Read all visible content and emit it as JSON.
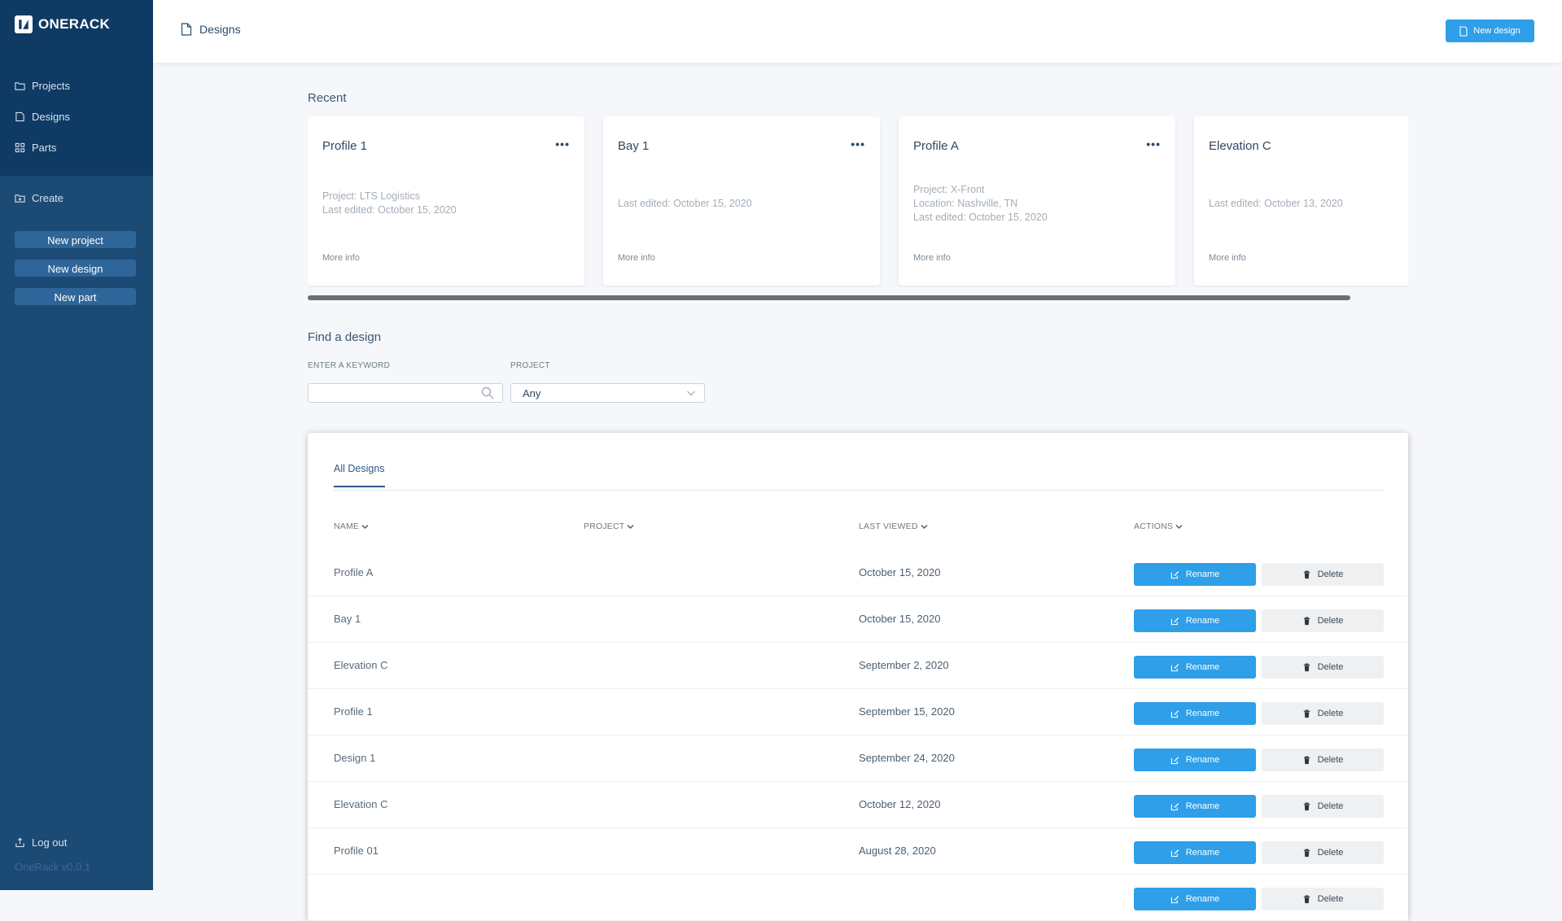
{
  "brand": {
    "name": "ONERACK"
  },
  "sidebar": {
    "nav": [
      {
        "label": "Projects",
        "icon": "folder-icon"
      },
      {
        "label": "Designs",
        "icon": "document-icon"
      },
      {
        "label": "Parts",
        "icon": "parts-icon"
      }
    ],
    "create_label": "Create",
    "create_buttons": [
      "New project",
      "New design",
      "New part"
    ],
    "logout": "Log out",
    "version": "OneRack v0.0.1"
  },
  "topbar": {
    "crumb": "Designs",
    "new_design": "New design"
  },
  "recent": {
    "title": "Recent",
    "cards": [
      {
        "title": "Profile 1",
        "meta": [
          "Project: LTS Logistics",
          "Last edited: October 15, 2020"
        ],
        "more": "More info"
      },
      {
        "title": "Bay 1",
        "meta": [
          "Last edited: October 15, 2020"
        ],
        "more": "More info"
      },
      {
        "title": "Profile A",
        "meta": [
          "Project: X-Front",
          "Location: Nashville, TN",
          "Last edited: October 15, 2020"
        ],
        "more": "More info"
      },
      {
        "title": "Elevation C",
        "meta": [
          "Last edited: October 13, 2020"
        ],
        "more": "More info"
      }
    ],
    "menu_glyph": "•••"
  },
  "find": {
    "title": "Find a design",
    "keyword_label": "ENTER A KEYWORD",
    "keyword_value": "",
    "project_label": "PROJECT",
    "project_value": "Any"
  },
  "table": {
    "tab": "All Designs",
    "headers": {
      "name": "NAME",
      "project": "PROJECT",
      "last_viewed": "LAST VIEWED",
      "actions": "ACTIONS"
    },
    "rename_label": "Rename",
    "delete_label": "Delete",
    "rows": [
      {
        "name": "Profile A",
        "project": "",
        "last_viewed": "October 15, 2020"
      },
      {
        "name": "Bay 1",
        "project": "",
        "last_viewed": "October 15, 2020"
      },
      {
        "name": "Elevation C",
        "project": "",
        "last_viewed": "September 2, 2020"
      },
      {
        "name": "Profile 1",
        "project": "",
        "last_viewed": "September 15, 2020"
      },
      {
        "name": "Design 1",
        "project": "",
        "last_viewed": "September 24, 2020"
      },
      {
        "name": "Elevation C",
        "project": "",
        "last_viewed": "October 12, 2020"
      },
      {
        "name": "Profile 01",
        "project": "",
        "last_viewed": "August 28, 2020"
      },
      {
        "name": "",
        "project": "",
        "last_viewed": ""
      }
    ]
  },
  "colors": {
    "sidebar_dark": "#0f3a63",
    "sidebar": "#1b4a74",
    "accent": "#2e9fe8",
    "delete_bg": "#eef0f2"
  }
}
